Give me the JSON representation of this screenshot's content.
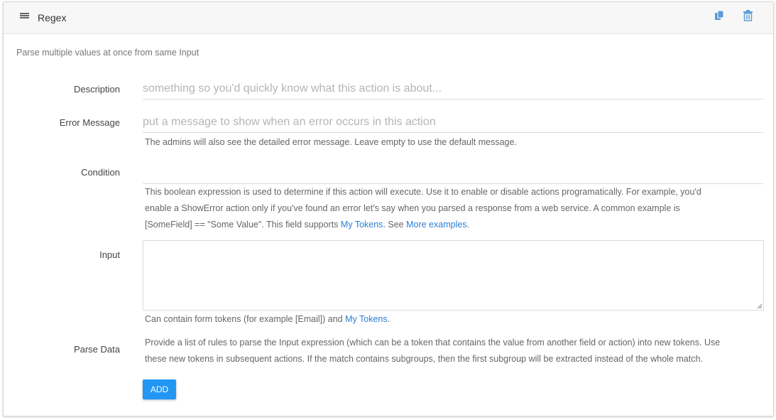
{
  "header": {
    "title": "Regex",
    "menu_icon": "hamburger-menu-icon",
    "copy_icon": "copy-icon",
    "delete_icon": "trash-icon",
    "icon_color": "#5a9bd8"
  },
  "subtitle": "Parse multiple values at once from same Input",
  "fields": {
    "description": {
      "label": "Description",
      "value": "",
      "placeholder": "something so you'd quickly know what this action is about..."
    },
    "error_message": {
      "label": "Error Message",
      "value": "",
      "placeholder": "put a message to show when an error occurs in this action",
      "help": "The admins will also see the detailed error message. Leave empty to use the default message."
    },
    "condition": {
      "label": "Condition",
      "value": "",
      "help_line1": "This boolean expression is used to determine if this action will execute. Use it to enable or disable actions programatically. For example, you'd",
      "help_line2": "enable a ShowError action only if you've found an error let's say when you parsed a response from a web service. A common example is",
      "help_line3_a": "[SomeField] == \"Some Value\". This field supports ",
      "help_link1": "My Tokens",
      "help_line3_b": ". See ",
      "help_link2": "More examples",
      "help_line3_c": "."
    },
    "input": {
      "label": "Input",
      "value": "",
      "help_a": "Can contain form tokens (for example [Email]) and ",
      "help_link": "My Tokens",
      "help_b": "."
    },
    "parse_data": {
      "label": "Parse Data",
      "help_line1": "Provide a list of rules to parse the Input expression (which can be a token that contains the value from another field or action) into new tokens. Use",
      "help_line2": "these new tokens in subsequent actions. If the match contains subgroups, then the first subgroup will be extracted instead of the whole match.",
      "add_button": "ADD"
    }
  },
  "colors": {
    "accent": "#2196f3",
    "link": "#2a7fd4"
  }
}
